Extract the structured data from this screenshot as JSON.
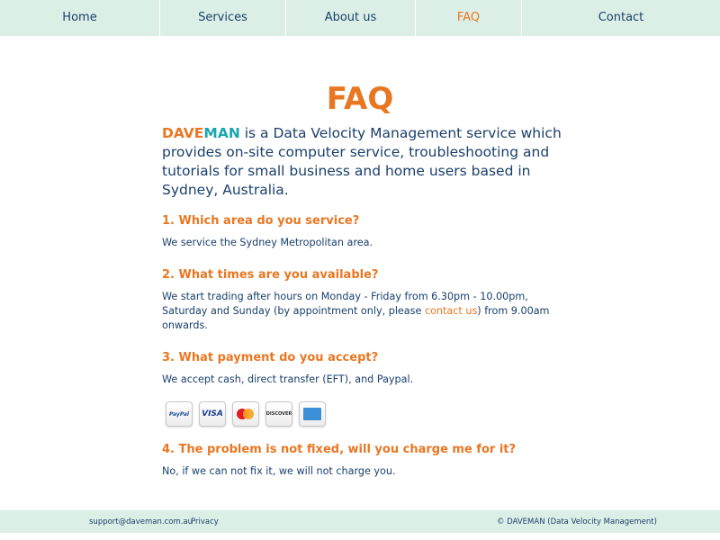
{
  "nav": {
    "items": [
      {
        "label": "Home"
      },
      {
        "label": "Services"
      },
      {
        "label": "About us"
      },
      {
        "label": "FAQ"
      },
      {
        "label": "Contact"
      }
    ]
  },
  "main": {
    "title": "FAQ",
    "brand_part1": "DAVE",
    "brand_part2": "MAN",
    "intro_text": " is a Data Velocity Management service which provides on-site computer service, troubleshooting and tutorials for small business and home users based in Sydney, Australia.",
    "faqs": [
      {
        "question": "1. Which area do you service?",
        "answer": "We service the Sydney Metropolitan area."
      },
      {
        "question": "2. What times are you available?",
        "answer_before": "We start trading after hours on Monday - Friday from 6.30pm - 10.00pm, Saturday and Sunday (by appointment only, please ",
        "answer_link": "contact us",
        "answer_after": ") from 9.00am onwards."
      },
      {
        "question": "3. What payment do you accept?",
        "answer": "We accept cash, direct transfer (EFT), and Paypal."
      },
      {
        "question": "4. The problem is not fixed, will you charge me for it?",
        "answer": "No, if we can not fix it, we will not charge you."
      }
    ],
    "payment_cards": {
      "paypal": "PayPal",
      "visa": "VISA",
      "discover": "DISCOVER"
    }
  },
  "footer": {
    "email": "support@daveman.com.au",
    "privacy": "Privacy",
    "copyright": "© DAVEMAN (Data Velocity Management)"
  },
  "colors": {
    "accent_orange": "#e87722",
    "brand_teal": "#1aa6b0",
    "text_navy": "#1b3f6b",
    "bar_mint": "#dcefe6"
  }
}
